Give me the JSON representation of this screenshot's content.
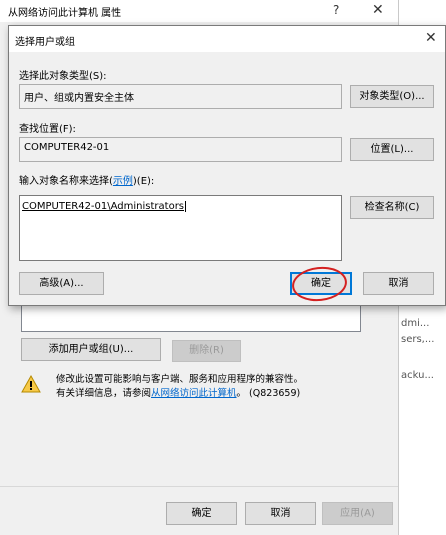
{
  "background_window": {
    "title": "从网络访问此计算机 属性",
    "help_glyph": "?",
    "close_glyph": "✕",
    "add_button": "添加用户或组(U)...",
    "remove_button": "删除(R)",
    "warning_line1": "修改此设置可能影响与客户端、服务和应用程序的兼容性。",
    "warning_line2_prefix": "有关详细信息，请参阅",
    "warning_link": "从网络访问此计算机",
    "warning_line2_suffix": "。 (Q823659)",
    "ok_button": "确定",
    "cancel_button": "取消",
    "apply_button": "应用(A)",
    "right_fragments": [
      "dmi...",
      "sers,...",
      "acku..."
    ]
  },
  "dialog": {
    "title": "选择用户或组",
    "close_glyph": "✕",
    "object_types_label": "选择此对象类型(S):",
    "object_types_value": "用户、组或内置安全主体",
    "object_types_button": "对象类型(O)...",
    "location_label": "查找位置(F):",
    "location_value": "COMPUTER42-01",
    "location_button": "位置(L)...",
    "names_label_prefix": "输入对象名称来选择(",
    "names_label_link": "示例",
    "names_label_suffix": ")(E):",
    "names_value": "COMPUTER42-01\\Administrators",
    "check_names_button": "检查名称(C)",
    "advanced_button": "高级(A)...",
    "ok_button": "确定",
    "cancel_button": "取消"
  }
}
